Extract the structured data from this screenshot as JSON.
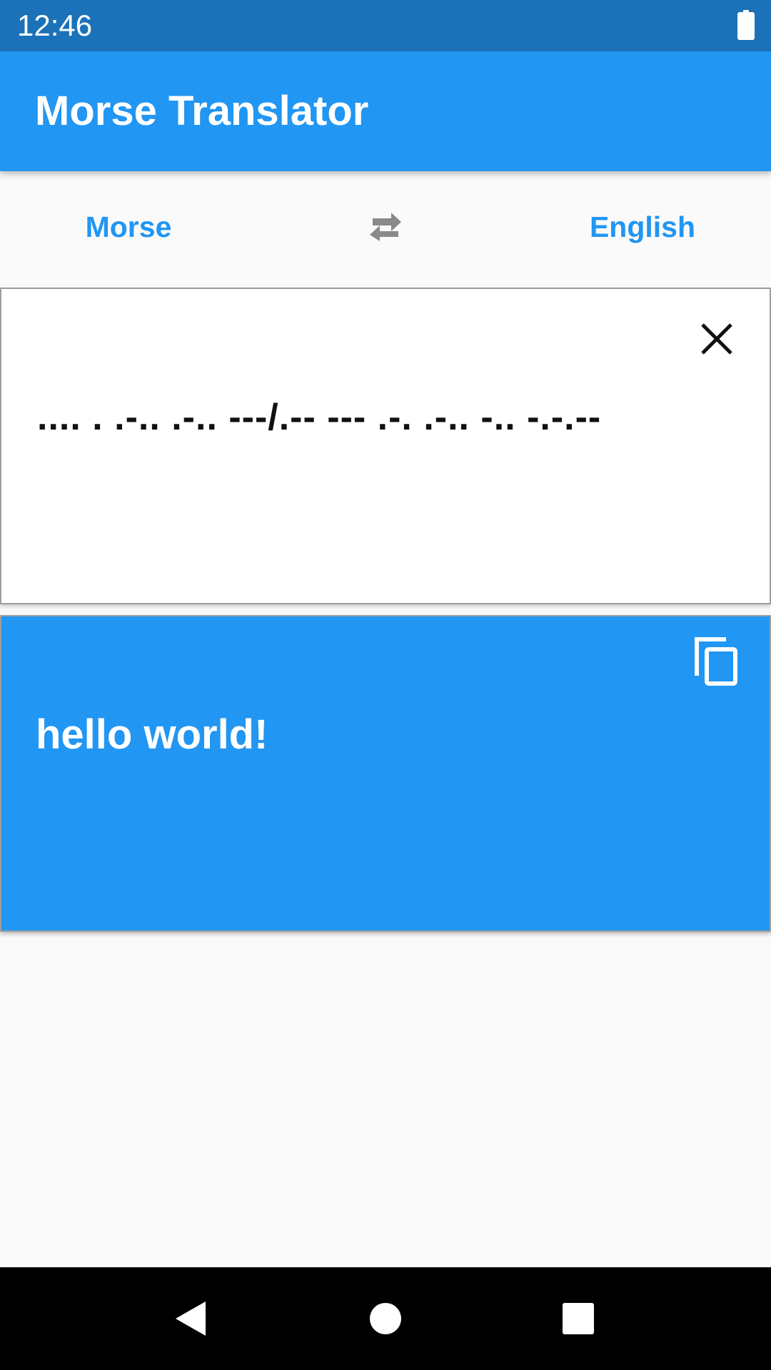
{
  "status_bar": {
    "time": "12:46",
    "battery_icon": "battery-full-icon"
  },
  "app_bar": {
    "title": "Morse Translator"
  },
  "language_row": {
    "source_label": "Morse",
    "target_label": "English",
    "swap_icon": "swap-horizontal-icon",
    "accent_color": "#2196f3"
  },
  "input_card": {
    "text": ".... . .-.. .-.. ---/.-- --- .-. .-.. -.. -.-.--",
    "clear_icon": "close-icon"
  },
  "output_card": {
    "text": "hello world!",
    "copy_icon": "copy-icon",
    "background_color": "#2196f3"
  },
  "nav_bar": {
    "back_icon": "back-triangle-icon",
    "home_icon": "home-circle-icon",
    "recents_icon": "recents-square-icon"
  }
}
